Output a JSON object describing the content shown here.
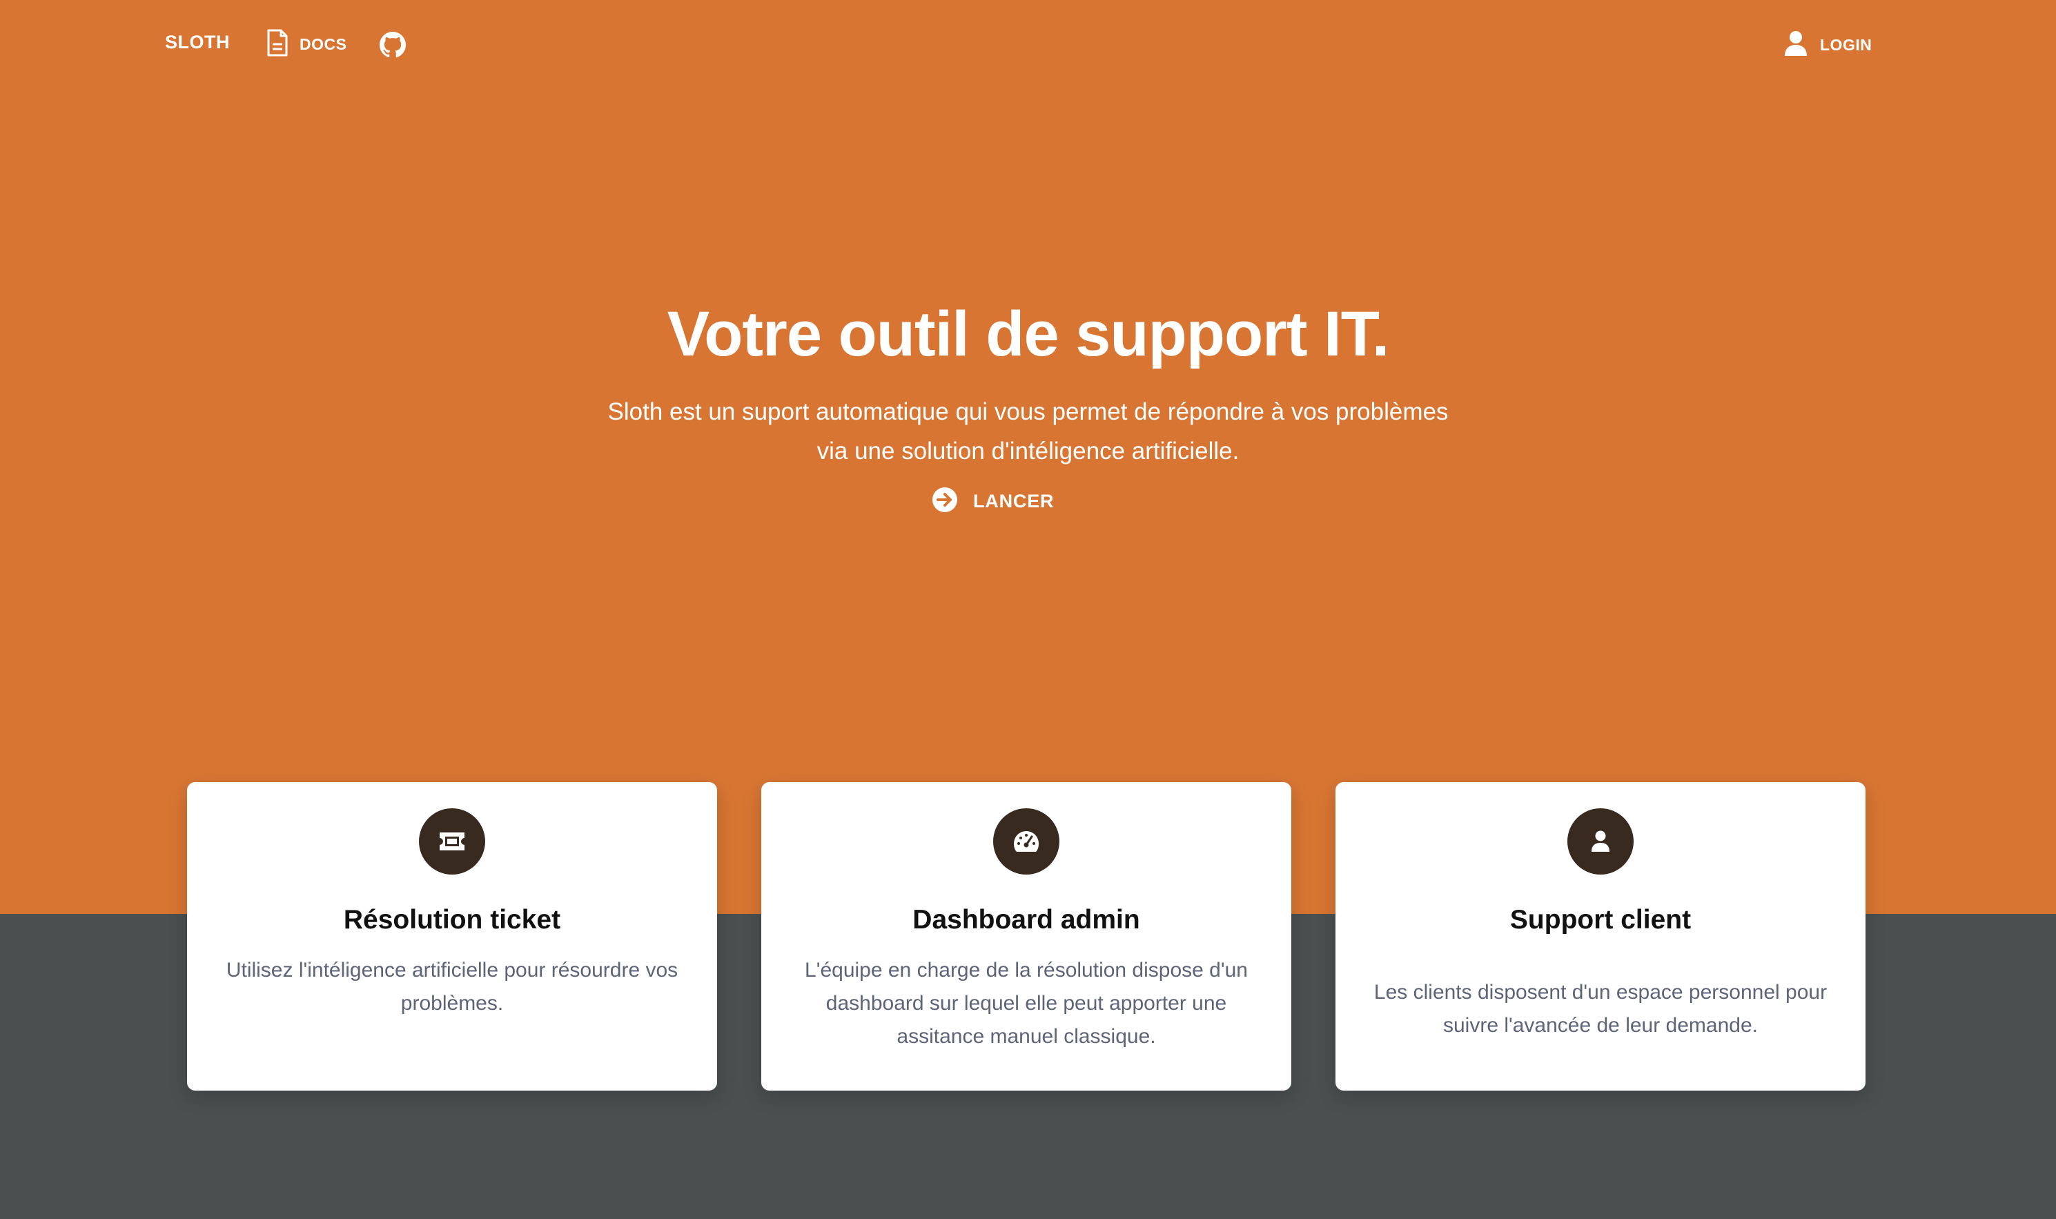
{
  "nav": {
    "brand": "SLOTH",
    "docs_label": "DOCS",
    "docs_icon": "document-icon",
    "github_icon": "github-icon",
    "login_label": "LOGIN",
    "login_icon": "user-icon"
  },
  "hero": {
    "title": "Votre outil de support IT.",
    "subtitle": "Sloth est un suport automatique qui vous permet de répondre à vos problèmes via une solution d'intéligence artificielle.",
    "cta_label": "LANCER",
    "cta_icon": "arrow-circle-right-icon"
  },
  "features": [
    {
      "icon": "ticket-icon",
      "title": "Résolution ticket",
      "description": "Utilisez l'intéligence artificielle pour résourdre vos problèmes."
    },
    {
      "icon": "gauge-icon",
      "title": "Dashboard admin",
      "description": "L'équipe en charge de la résolution dispose d'un dashboard sur lequel elle peut apporter une assitance manuel classique."
    },
    {
      "icon": "user-icon",
      "title": "Support client",
      "description": "Les clients disposent d'un espace personnel pour suivre l'avancée de leur demande."
    }
  ],
  "colors": {
    "hero_background": "#d87533",
    "lower_background": "#4a5050",
    "card_background": "#ffffff",
    "icon_badge": "#382a1e",
    "description_text": "#5d6478"
  }
}
